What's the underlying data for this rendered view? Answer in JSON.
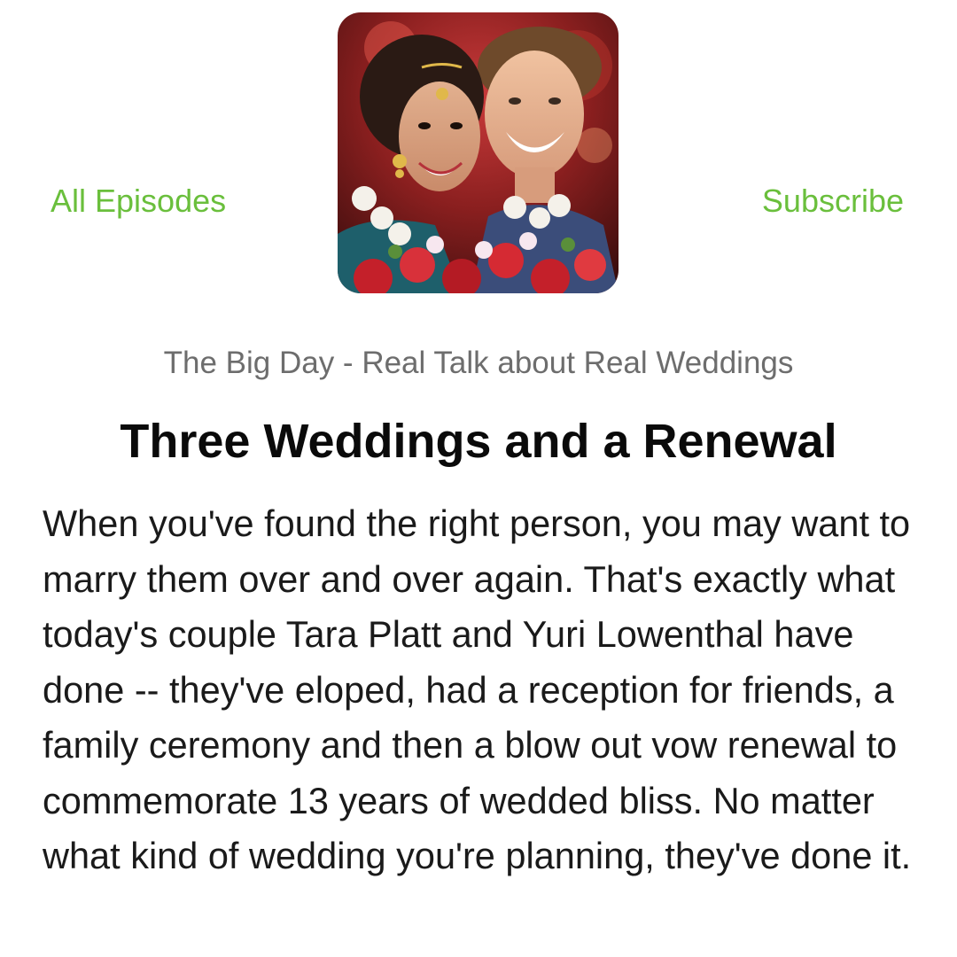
{
  "nav": {
    "left_label": "All Episodes",
    "right_label": "Subscribe"
  },
  "artwork": {
    "icon": "podcast-artwork-image"
  },
  "episode": {
    "show_title": "The Big Day - Real Talk about Real Weddings",
    "title": "Three Weddings and a Renewal",
    "description": "When you've found the right person, you may want to marry them over and over again. That's exactly what today's couple Tara Platt and Yuri Lowenthal have done -- they've eloped, had a reception for friends, a family ceremony and then a blow out vow renewal to commemorate 13 years of wedded bliss. No matter what kind of wedding you're planning, they've done it."
  },
  "colors": {
    "accent": "#6abf3c",
    "show_title": "#6d6d6d",
    "text": "#0a0a0a",
    "background": "#ffffff"
  }
}
